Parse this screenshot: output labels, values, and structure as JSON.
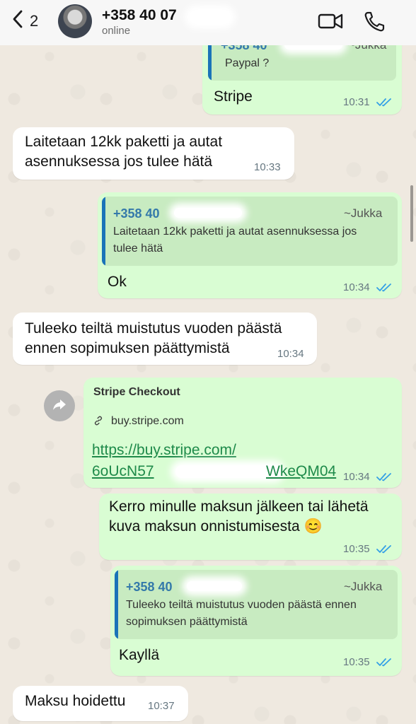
{
  "header": {
    "back_count": "2",
    "contact_name": "+358 40 07",
    "status": "online"
  },
  "messages": [
    {
      "quote_phone": "+358 40",
      "quote_author": "~Jukka",
      "quote_text": "Paypal ?",
      "text": "Stripe",
      "time": "10:31"
    },
    {
      "text_line1": "Laitetaan 12kk paketti ja autat",
      "text_line2": "asennuksessa jos tulee hätä",
      "time": "10:33"
    },
    {
      "quote_phone": "+358 40",
      "quote_author": "~Jukka",
      "quote_line1": "Laitetaan 12kk paketti ja autat asennuksessa jos",
      "quote_line2": "tulee hätä",
      "text": "Ok",
      "time": "10:34"
    },
    {
      "text_line1": "Tuleeko teiltä muistutus vuoden päästä",
      "text_line2": "ennen sopimuksen päättymistä",
      "time": "10:34"
    },
    {
      "preview_title": "Stripe Checkout",
      "domain": "buy.stripe.com",
      "url_line1": "https://buy.stripe.com/",
      "url_line2": "6oUcN57",
      "url_line2_end": "WkeQM04",
      "time": "10:34"
    },
    {
      "text_line1": "Kerro minulle maksun jälkeen tai lähetä",
      "text_line2": "kuva maksun onnistumisesta 😊",
      "time": "10:35"
    },
    {
      "quote_phone": "+358 40",
      "quote_author": "~Jukka",
      "quote_line1": "Tuleeko teiltä muistutus vuoden päästä ennen",
      "quote_line2": "sopimuksen päättymistä",
      "text": "Kayllä",
      "time": "10:35"
    },
    {
      "text": "Maksu hoidettu",
      "time": "10:37"
    }
  ],
  "colors": {
    "outgoing_bubble": "#d9fdd3",
    "incoming_bubble": "#ffffff",
    "read_ticks": "#34a0e6",
    "quote_bar": "#1a73b8",
    "link": "#1e8a4a"
  },
  "icons": [
    "back-chevron-icon",
    "video-call-icon",
    "phone-icon",
    "double-check-icon",
    "link-icon",
    "forward-icon"
  ]
}
